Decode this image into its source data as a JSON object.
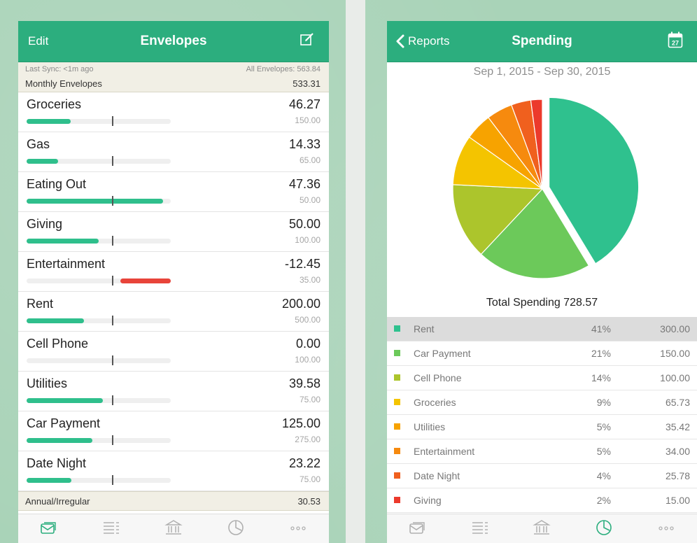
{
  "left": {
    "nav": {
      "edit": "Edit",
      "title": "Envelopes"
    },
    "sync": {
      "last_sync": "Last Sync: <1m ago",
      "all_envelopes": "All Envelopes: 563.84",
      "group_label": "Monthly Envelopes",
      "group_value": "533.31"
    },
    "envelopes": [
      {
        "name": "Groceries",
        "amount": "46.27",
        "budget": "150.00",
        "fill_pct": 30.8,
        "over": false
      },
      {
        "name": "Gas",
        "amount": "14.33",
        "budget": "65.00",
        "fill_pct": 22,
        "over": false
      },
      {
        "name": "Eating Out",
        "amount": "47.36",
        "budget": "50.00",
        "fill_pct": 94.7,
        "over": false
      },
      {
        "name": "Giving",
        "amount": "50.00",
        "budget": "100.00",
        "fill_pct": 50,
        "over": false
      },
      {
        "name": "Entertainment",
        "amount": "-12.45",
        "budget": "35.00",
        "fill_pct": 35,
        "over": true
      },
      {
        "name": "Rent",
        "amount": "200.00",
        "budget": "500.00",
        "fill_pct": 40,
        "over": false
      },
      {
        "name": "Cell Phone",
        "amount": "0.00",
        "budget": "100.00",
        "fill_pct": 0,
        "over": false
      },
      {
        "name": "Utilities",
        "amount": "39.58",
        "budget": "75.00",
        "fill_pct": 52.8,
        "over": false
      },
      {
        "name": "Car Payment",
        "amount": "125.00",
        "budget": "275.00",
        "fill_pct": 45.5,
        "over": false
      },
      {
        "name": "Date Night",
        "amount": "23.22",
        "budget": "75.00",
        "fill_pct": 31,
        "over": false
      }
    ],
    "annual": {
      "label": "Annual/Irregular",
      "value": "30.53"
    },
    "tabs": [
      "envelopes-icon",
      "transactions-icon",
      "accounts-icon",
      "reports-icon",
      "more-icon"
    ],
    "active_tab": 0
  },
  "right": {
    "nav": {
      "back": "Reports",
      "title": "Spending",
      "calendar_day": "27"
    },
    "date_range": "Sep 1, 2015 - Sep 30, 2015",
    "total": "Total Spending 728.57",
    "selected_index": 0,
    "tabs": [
      "envelopes-icon",
      "transactions-icon",
      "accounts-icon",
      "reports-icon",
      "more-icon"
    ],
    "active_tab": 3
  },
  "chart_data": {
    "type": "pie",
    "title": "",
    "slices": [
      {
        "label": "Rent",
        "pct": "41%",
        "value": 300.0,
        "display": "300.00",
        "color": "#2fc18e"
      },
      {
        "label": "Car Payment",
        "pct": "21%",
        "value": 150.0,
        "display": "150.00",
        "color": "#6cc95a"
      },
      {
        "label": "Cell Phone",
        "pct": "14%",
        "value": 100.0,
        "display": "100.00",
        "color": "#acc52c"
      },
      {
        "label": "Groceries",
        "pct": "9%",
        "value": 65.73,
        "display": "65.73",
        "color": "#f4c400"
      },
      {
        "label": "Utilities",
        "pct": "5%",
        "value": 35.42,
        "display": "35.42",
        "color": "#f7a300"
      },
      {
        "label": "Entertainment",
        "pct": "5%",
        "value": 34.0,
        "display": "34.00",
        "color": "#f68a0e"
      },
      {
        "label": "Date Night",
        "pct": "4%",
        "value": 25.78,
        "display": "25.78",
        "color": "#f0601e"
      },
      {
        "label": "Giving",
        "pct": "2%",
        "value": 15.0,
        "display": "15.00",
        "color": "#ec3a2c"
      }
    ]
  },
  "colors": {
    "brand": "#2cae7e",
    "good_bar": "#2fbf8c",
    "over_bar": "#e8443a"
  }
}
